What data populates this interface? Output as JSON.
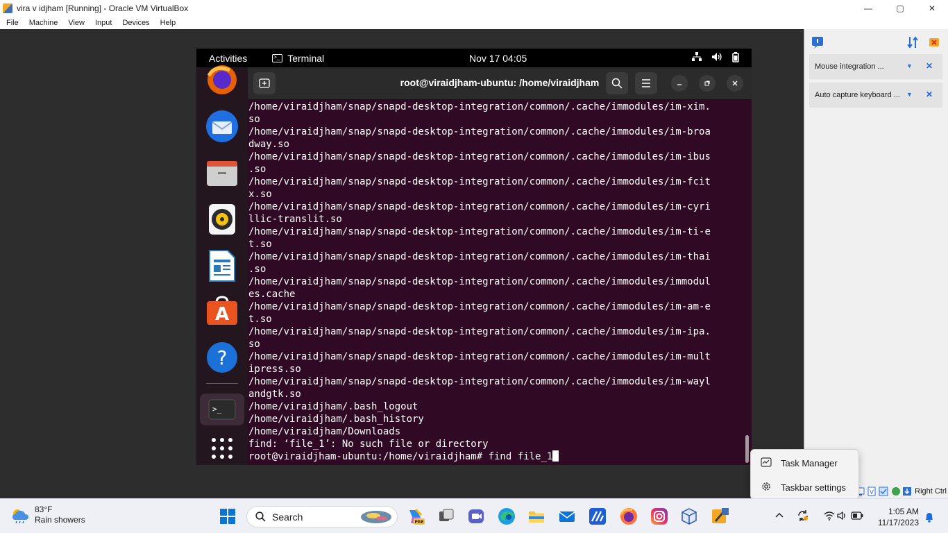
{
  "vbox_window": {
    "title": "vira v idjham  [Running] - Oracle VM VirtualBox",
    "minimize": "—",
    "maximize": "▢",
    "close": "✕"
  },
  "vbox_menu": [
    "File",
    "Machine",
    "View",
    "Input",
    "Devices",
    "Help"
  ],
  "guest_topbar": {
    "activities": "Activities",
    "app_name": "Terminal",
    "clock": "Nov 17  04:05"
  },
  "terminal": {
    "title": "root@viraidjham-ubuntu: /home/viraidjham",
    "lines": [
      "/home/viraidjham/snap/snapd-desktop-integration/common/.cache/immodules/im-xim.",
      "so",
      "/home/viraidjham/snap/snapd-desktop-integration/common/.cache/immodules/im-broa",
      "dway.so",
      "/home/viraidjham/snap/snapd-desktop-integration/common/.cache/immodules/im-ibus",
      ".so",
      "/home/viraidjham/snap/snapd-desktop-integration/common/.cache/immodules/im-fcit",
      "x.so",
      "/home/viraidjham/snap/snapd-desktop-integration/common/.cache/immodules/im-cyri",
      "llic-translit.so",
      "/home/viraidjham/snap/snapd-desktop-integration/common/.cache/immodules/im-ti-e",
      "t.so",
      "/home/viraidjham/snap/snapd-desktop-integration/common/.cache/immodules/im-thai",
      ".so",
      "/home/viraidjham/snap/snapd-desktop-integration/common/.cache/immodules/immodul",
      "es.cache",
      "/home/viraidjham/snap/snapd-desktop-integration/common/.cache/immodules/im-am-e",
      "t.so",
      "/home/viraidjham/snap/snapd-desktop-integration/common/.cache/immodules/im-ipa.",
      "so",
      "/home/viraidjham/snap/snapd-desktop-integration/common/.cache/immodules/im-mult",
      "ipress.so",
      "/home/viraidjham/snap/snapd-desktop-integration/common/.cache/immodules/im-wayl",
      "andgtk.so",
      "/home/viraidjham/.bash_logout",
      "/home/viraidjham/.bash_history",
      "/home/viraidjham/Downloads",
      "find: ‘file_1’: No such file or directory"
    ],
    "prompt": "root@viraidjham-ubuntu:/home/viraidjham# find file_1"
  },
  "dock_apps": [
    "firefox-icon",
    "thunderbird-icon",
    "files-icon",
    "rhythmbox-icon",
    "libreoffice-writer-icon",
    "app-center-icon",
    "help-icon",
    "terminal-icon",
    "show-apps-icon"
  ],
  "vbox_notifications": [
    {
      "label": "Mouse integration ..."
    },
    {
      "label": "Auto capture keyboard ..."
    }
  ],
  "vbox_status": {
    "host_key": "Right Ctrl"
  },
  "context_menu": {
    "task_manager": "Task Manager",
    "taskbar_settings": "Taskbar settings"
  },
  "taskbar": {
    "weather_temp": "83°F",
    "weather_desc": "Rain showers",
    "search_label": "Search",
    "time": "1:05 AM",
    "date": "11/17/2023",
    "copilot_badge": "PRE"
  },
  "colors": {
    "terminal_bg": "#300a24",
    "taskbar_bg": "#eef0f5",
    "accent": "#1e64d6"
  }
}
